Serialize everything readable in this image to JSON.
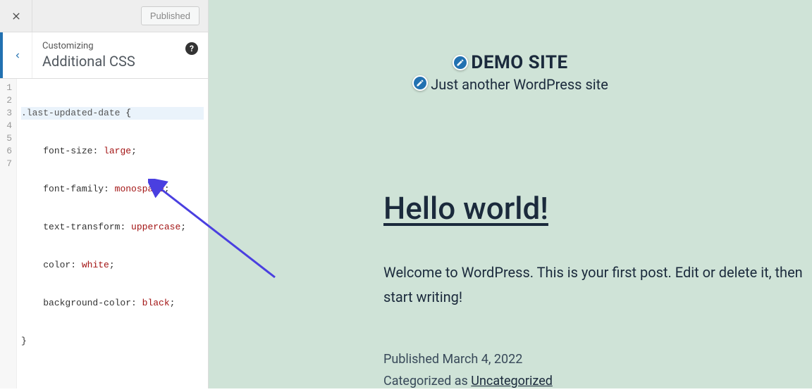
{
  "topbar": {
    "published_label": "Published"
  },
  "panel": {
    "crumb": "Customizing",
    "title": "Additional CSS",
    "help": "?"
  },
  "code": {
    "gutter": [
      "1",
      "2",
      "3",
      "4",
      "5",
      "6",
      "7"
    ],
    "lines": [
      {
        "selector": ".last-updated-date",
        "brace": " {"
      },
      {
        "indent": "    ",
        "prop": "font-size",
        "colon": ": ",
        "val": "large",
        "semi": ";"
      },
      {
        "indent": "    ",
        "prop": "font-family",
        "colon": ": ",
        "val": "monospace",
        "semi": ";"
      },
      {
        "indent": "    ",
        "prop": "text-transform",
        "colon": ": ",
        "val": "uppercase",
        "semi": ";"
      },
      {
        "indent": "    ",
        "prop": "color",
        "colon": ": ",
        "val": "white",
        "semi": ";"
      },
      {
        "indent": "    ",
        "prop": "background-color",
        "colon": ": ",
        "val": "black",
        "semi": ";"
      },
      {
        "brace": "}"
      }
    ]
  },
  "preview": {
    "site_title": "DEMO SITE",
    "site_tagline": "Just another WordPress site",
    "post_title": "Hello world!",
    "post_body": "Welcome to WordPress. This is your first post. Edit or delete it, then start writing!",
    "published_prefix": "Published ",
    "published_date": "March 4, 2022",
    "cat_prefix": "Categorized as ",
    "cat_link": "Uncategorized"
  }
}
